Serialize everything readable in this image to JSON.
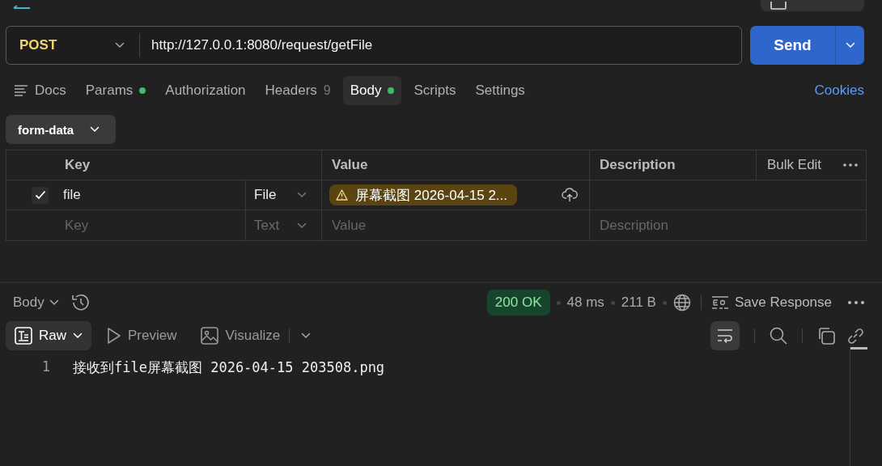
{
  "request": {
    "method": "POST",
    "url": "http://127.0.0.1:8080/request/getFile",
    "send": "Send"
  },
  "tabs": [
    {
      "kind": "docs",
      "label": "Docs",
      "selected": false,
      "dot": false
    },
    {
      "kind": "tab",
      "label": "Params",
      "selected": false,
      "dot": true
    },
    {
      "kind": "tab",
      "label": "Authorization",
      "selected": false,
      "dot": false
    },
    {
      "kind": "tab",
      "label": "Headers",
      "count": "9",
      "selected": false,
      "dot": false
    },
    {
      "kind": "tab",
      "label": "Body",
      "selected": true,
      "dot": true
    },
    {
      "kind": "tab",
      "label": "Scripts",
      "selected": false,
      "dot": false
    },
    {
      "kind": "tab",
      "label": "Settings",
      "selected": false,
      "dot": false
    }
  ],
  "cookies": "Cookies",
  "body_mode": "form-data",
  "table": {
    "columns": [
      "Key",
      "Value",
      "Description"
    ],
    "bulk_edit": "Bulk Edit",
    "rows": [
      {
        "kind": "file",
        "checked": true,
        "key": "file",
        "type": "File",
        "value": "屏幕截图 2026-04-15 2..."
      },
      {
        "kind": "new",
        "type": "Text",
        "key": {
          "placeholder": "Key"
        },
        "value": {
          "placeholder": "Value"
        },
        "description": {
          "placeholder": "Description"
        }
      }
    ]
  },
  "response": {
    "view": "Body",
    "status": "200 OK",
    "time": "48 ms",
    "size": "211 B",
    "save": "Save Response",
    "wrap_on": true,
    "formats": [
      {
        "kind": "raw",
        "label": "Raw",
        "selected": true
      },
      {
        "kind": "preview",
        "label": "Preview",
        "selected": false
      },
      {
        "kind": "visualize",
        "label": "Visualize",
        "selected": false
      }
    ],
    "lines": [
      {
        "number": "1",
        "text": "接收到file屏幕截图 2026-04-15 203508.png"
      }
    ]
  }
}
